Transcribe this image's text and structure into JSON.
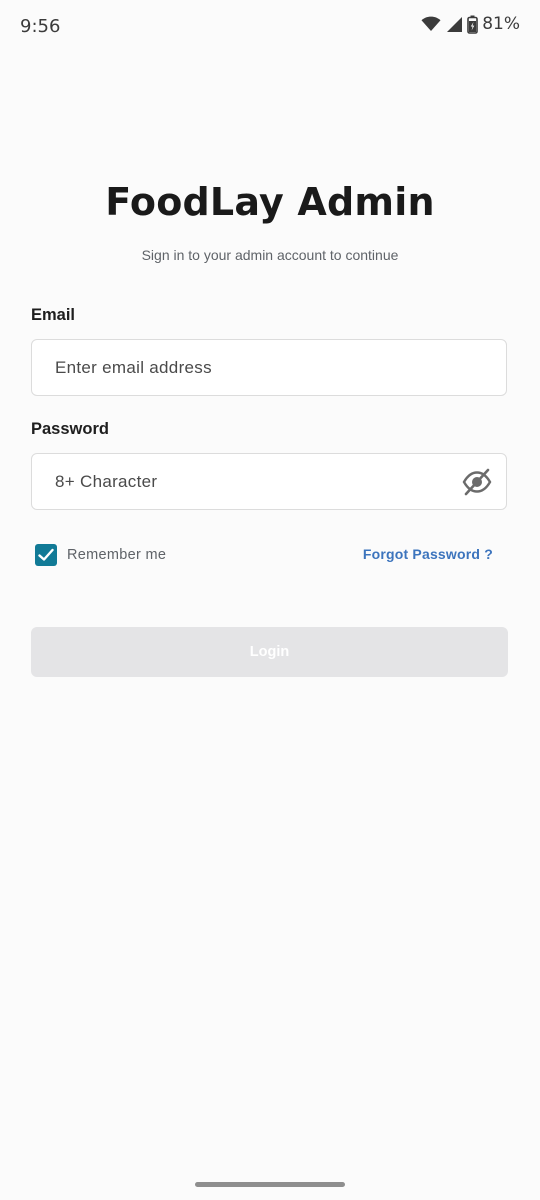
{
  "status_bar": {
    "time": "9:56",
    "battery": "81%",
    "icons": [
      "wifi-icon",
      "signal-icon",
      "battery-icon"
    ]
  },
  "header": {
    "title": "FoodLay Admin",
    "subtitle": "Sign in to your admin account to continue"
  },
  "form": {
    "email": {
      "label": "Email",
      "placeholder": "Enter email address",
      "value": ""
    },
    "password": {
      "label": "Password",
      "placeholder": "8+ Character",
      "value": "",
      "toggle_icon": "eye-off-icon"
    },
    "remember_me": {
      "label": "Remember me",
      "checked": true
    },
    "forgot_password": "Forgot Password ?",
    "login_label": "Login"
  },
  "colors": {
    "accent": "#117a96",
    "link": "#3c74bd",
    "button_disabled": "#e4e4e6",
    "background": "#fbfbfb"
  }
}
